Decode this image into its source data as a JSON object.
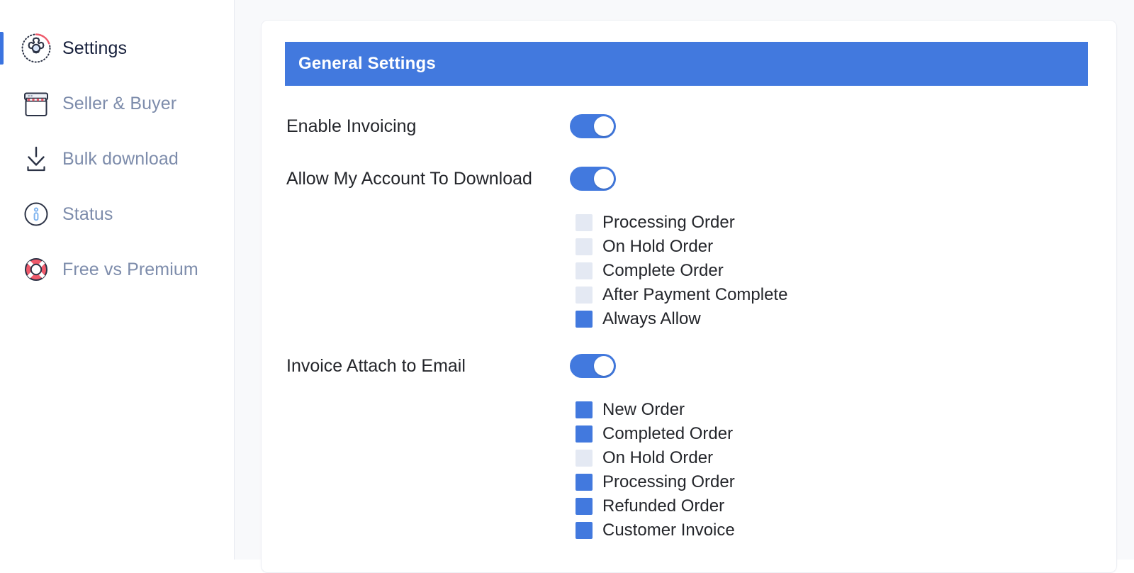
{
  "sidebar": {
    "items": [
      {
        "label": "Settings",
        "icon": "gear-settings-icon",
        "active": true
      },
      {
        "label": "Seller & Buyer",
        "icon": "storefront-icon",
        "active": false
      },
      {
        "label": "Bulk download",
        "icon": "download-icon",
        "active": false
      },
      {
        "label": "Status",
        "icon": "info-circle-icon",
        "active": false
      },
      {
        "label": "Free vs Premium",
        "icon": "lifebuoy-icon",
        "active": false
      }
    ]
  },
  "panel": {
    "header_title": "General Settings",
    "rows": [
      {
        "label": "Enable Invoicing",
        "toggle_on": true
      },
      {
        "label": "Allow My Account To Download",
        "toggle_on": true
      },
      {
        "label": "Invoice Attach to Email",
        "toggle_on": true
      }
    ],
    "download_options": [
      {
        "label": "Processing Order",
        "checked": false
      },
      {
        "label": "On Hold Order",
        "checked": false
      },
      {
        "label": "Complete Order",
        "checked": false
      },
      {
        "label": "After Payment Complete",
        "checked": false
      },
      {
        "label": "Always Allow",
        "checked": true
      }
    ],
    "email_options": [
      {
        "label": "New Order",
        "checked": true
      },
      {
        "label": "Completed Order",
        "checked": true
      },
      {
        "label": "On Hold Order",
        "checked": false
      },
      {
        "label": "Processing Order",
        "checked": true
      },
      {
        "label": "Refunded Order",
        "checked": true
      },
      {
        "label": "Customer Invoice",
        "checked": true
      }
    ]
  },
  "colors": {
    "accent": "#4279de",
    "sidebar_inactive_text": "#7d8cab",
    "sidebar_active_text": "#17203c",
    "checkbox_off": "#e4e9f3",
    "page_bg": "#f8f9fb",
    "icon_red": "#ef5a6b"
  }
}
